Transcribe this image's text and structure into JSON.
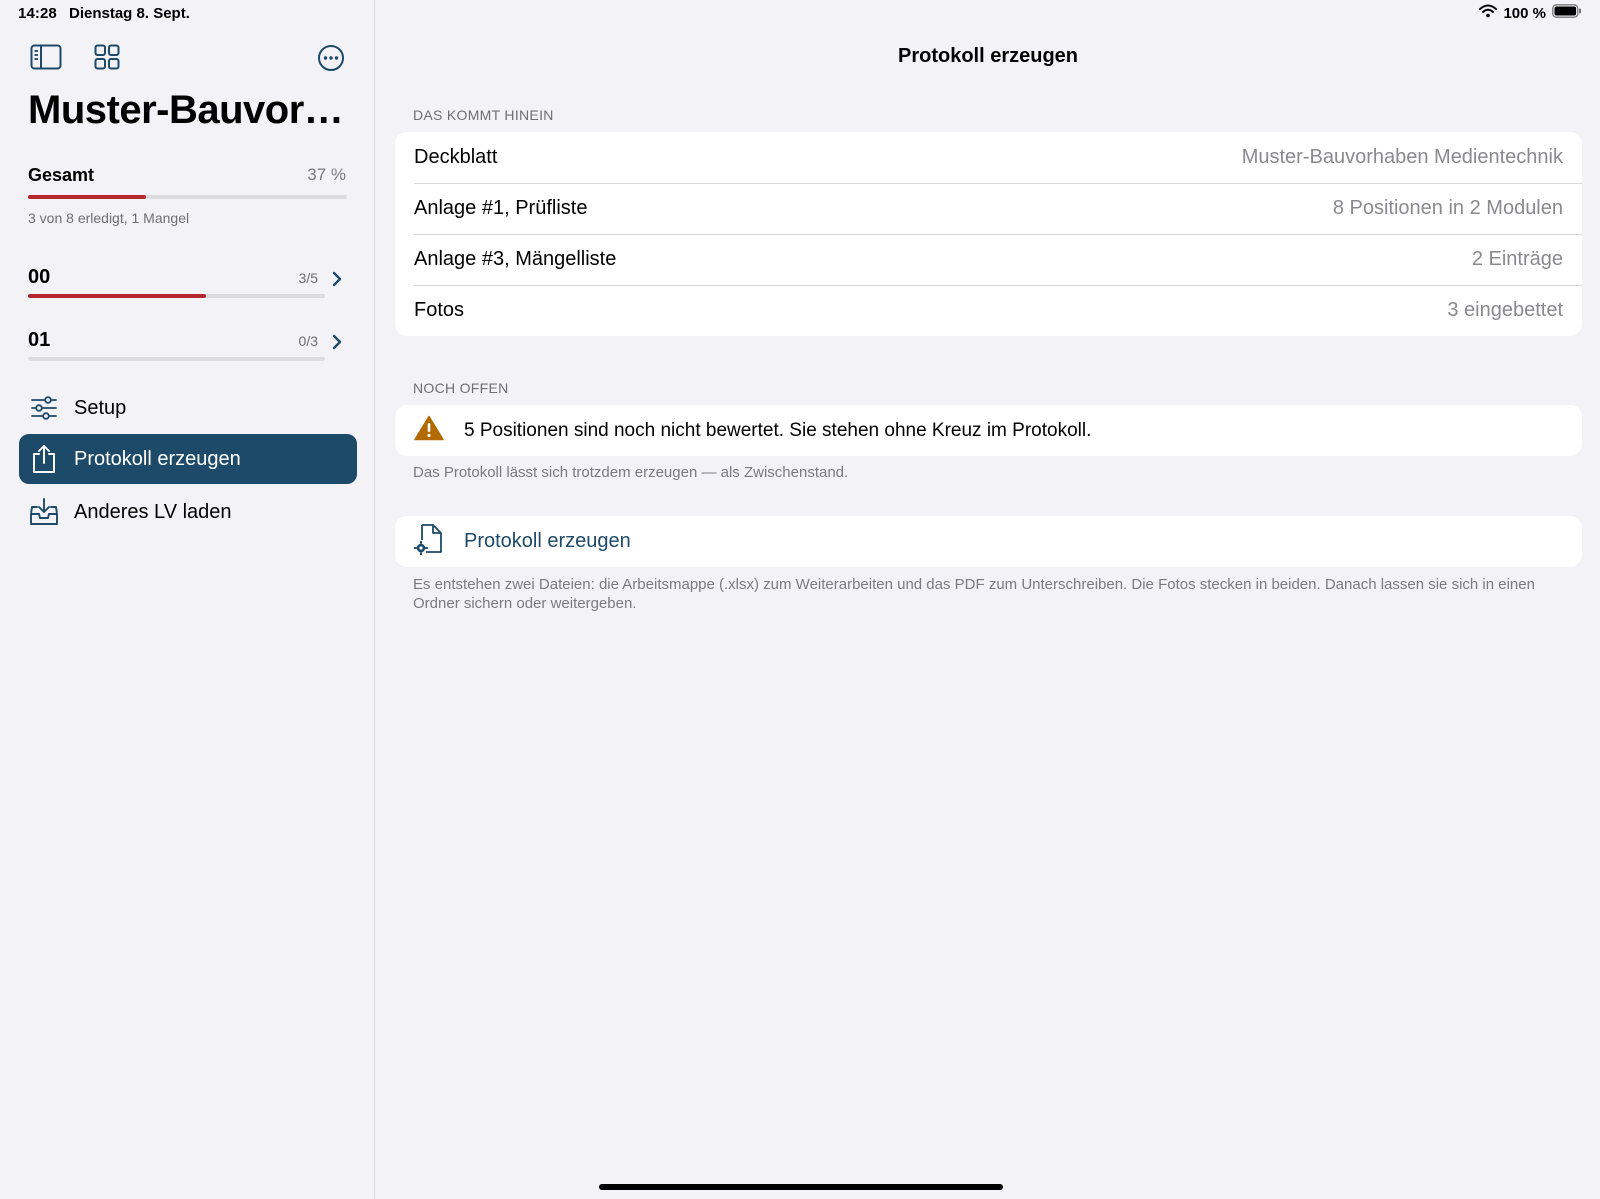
{
  "status_bar": {
    "time": "14:28",
    "date": "Dienstag 8. Sept.",
    "battery": "100 %"
  },
  "sidebar": {
    "project_title": "Muster-Bauvor…",
    "overall": {
      "label": "Gesamt",
      "percent_text": "37 %",
      "progress": 0.37,
      "summary": "3 von 8 erledigt, 1 Mangel"
    },
    "modules": [
      {
        "name": "00",
        "count": "3/5",
        "progress": 0.6
      },
      {
        "name": "01",
        "count": "0/3",
        "progress": 0
      }
    ],
    "nav": [
      {
        "label": "Setup",
        "icon": "sliders-icon",
        "active": false
      },
      {
        "label": "Protokoll erzeugen",
        "icon": "share-icon",
        "active": true
      },
      {
        "label": "Anderes LV laden",
        "icon": "tray-download-icon",
        "active": false
      }
    ]
  },
  "detail": {
    "title": "Protokoll erzeugen",
    "section_contents": {
      "header": "DAS KOMMT HINEIN",
      "rows": [
        {
          "label": "Deckblatt",
          "value": "Muster-Bauvorhaben Medientechnik"
        },
        {
          "label": "Anlage #1, Prüfliste",
          "value": "8 Positionen in 2 Modulen"
        },
        {
          "label": "Anlage #3, Mängelliste",
          "value": "2 Einträge"
        },
        {
          "label": "Fotos",
          "value": "3 eingebettet"
        }
      ]
    },
    "section_open": {
      "header": "NOCH OFFEN",
      "warning": "5 Positionen sind noch nicht bewertet. Sie stehen ohne Kreuz im Protokoll.",
      "note": "Das Protokoll lässt sich trotzdem erzeugen — als Zwischenstand."
    },
    "action": {
      "label": "Protokoll erzeugen",
      "note": "Es entstehen zwei Dateien: die Arbeitsmappe (.xlsx) zum Weiterarbeiten und das PDF zum Unterschreiben. Die Fotos stecken in beiden. Danach lassen sie sich in einen Ordner sichern oder weitergeben."
    }
  },
  "colors": {
    "accent": "#1d4a68",
    "progress_red": "#b5262e",
    "warning": "#b26b00"
  }
}
